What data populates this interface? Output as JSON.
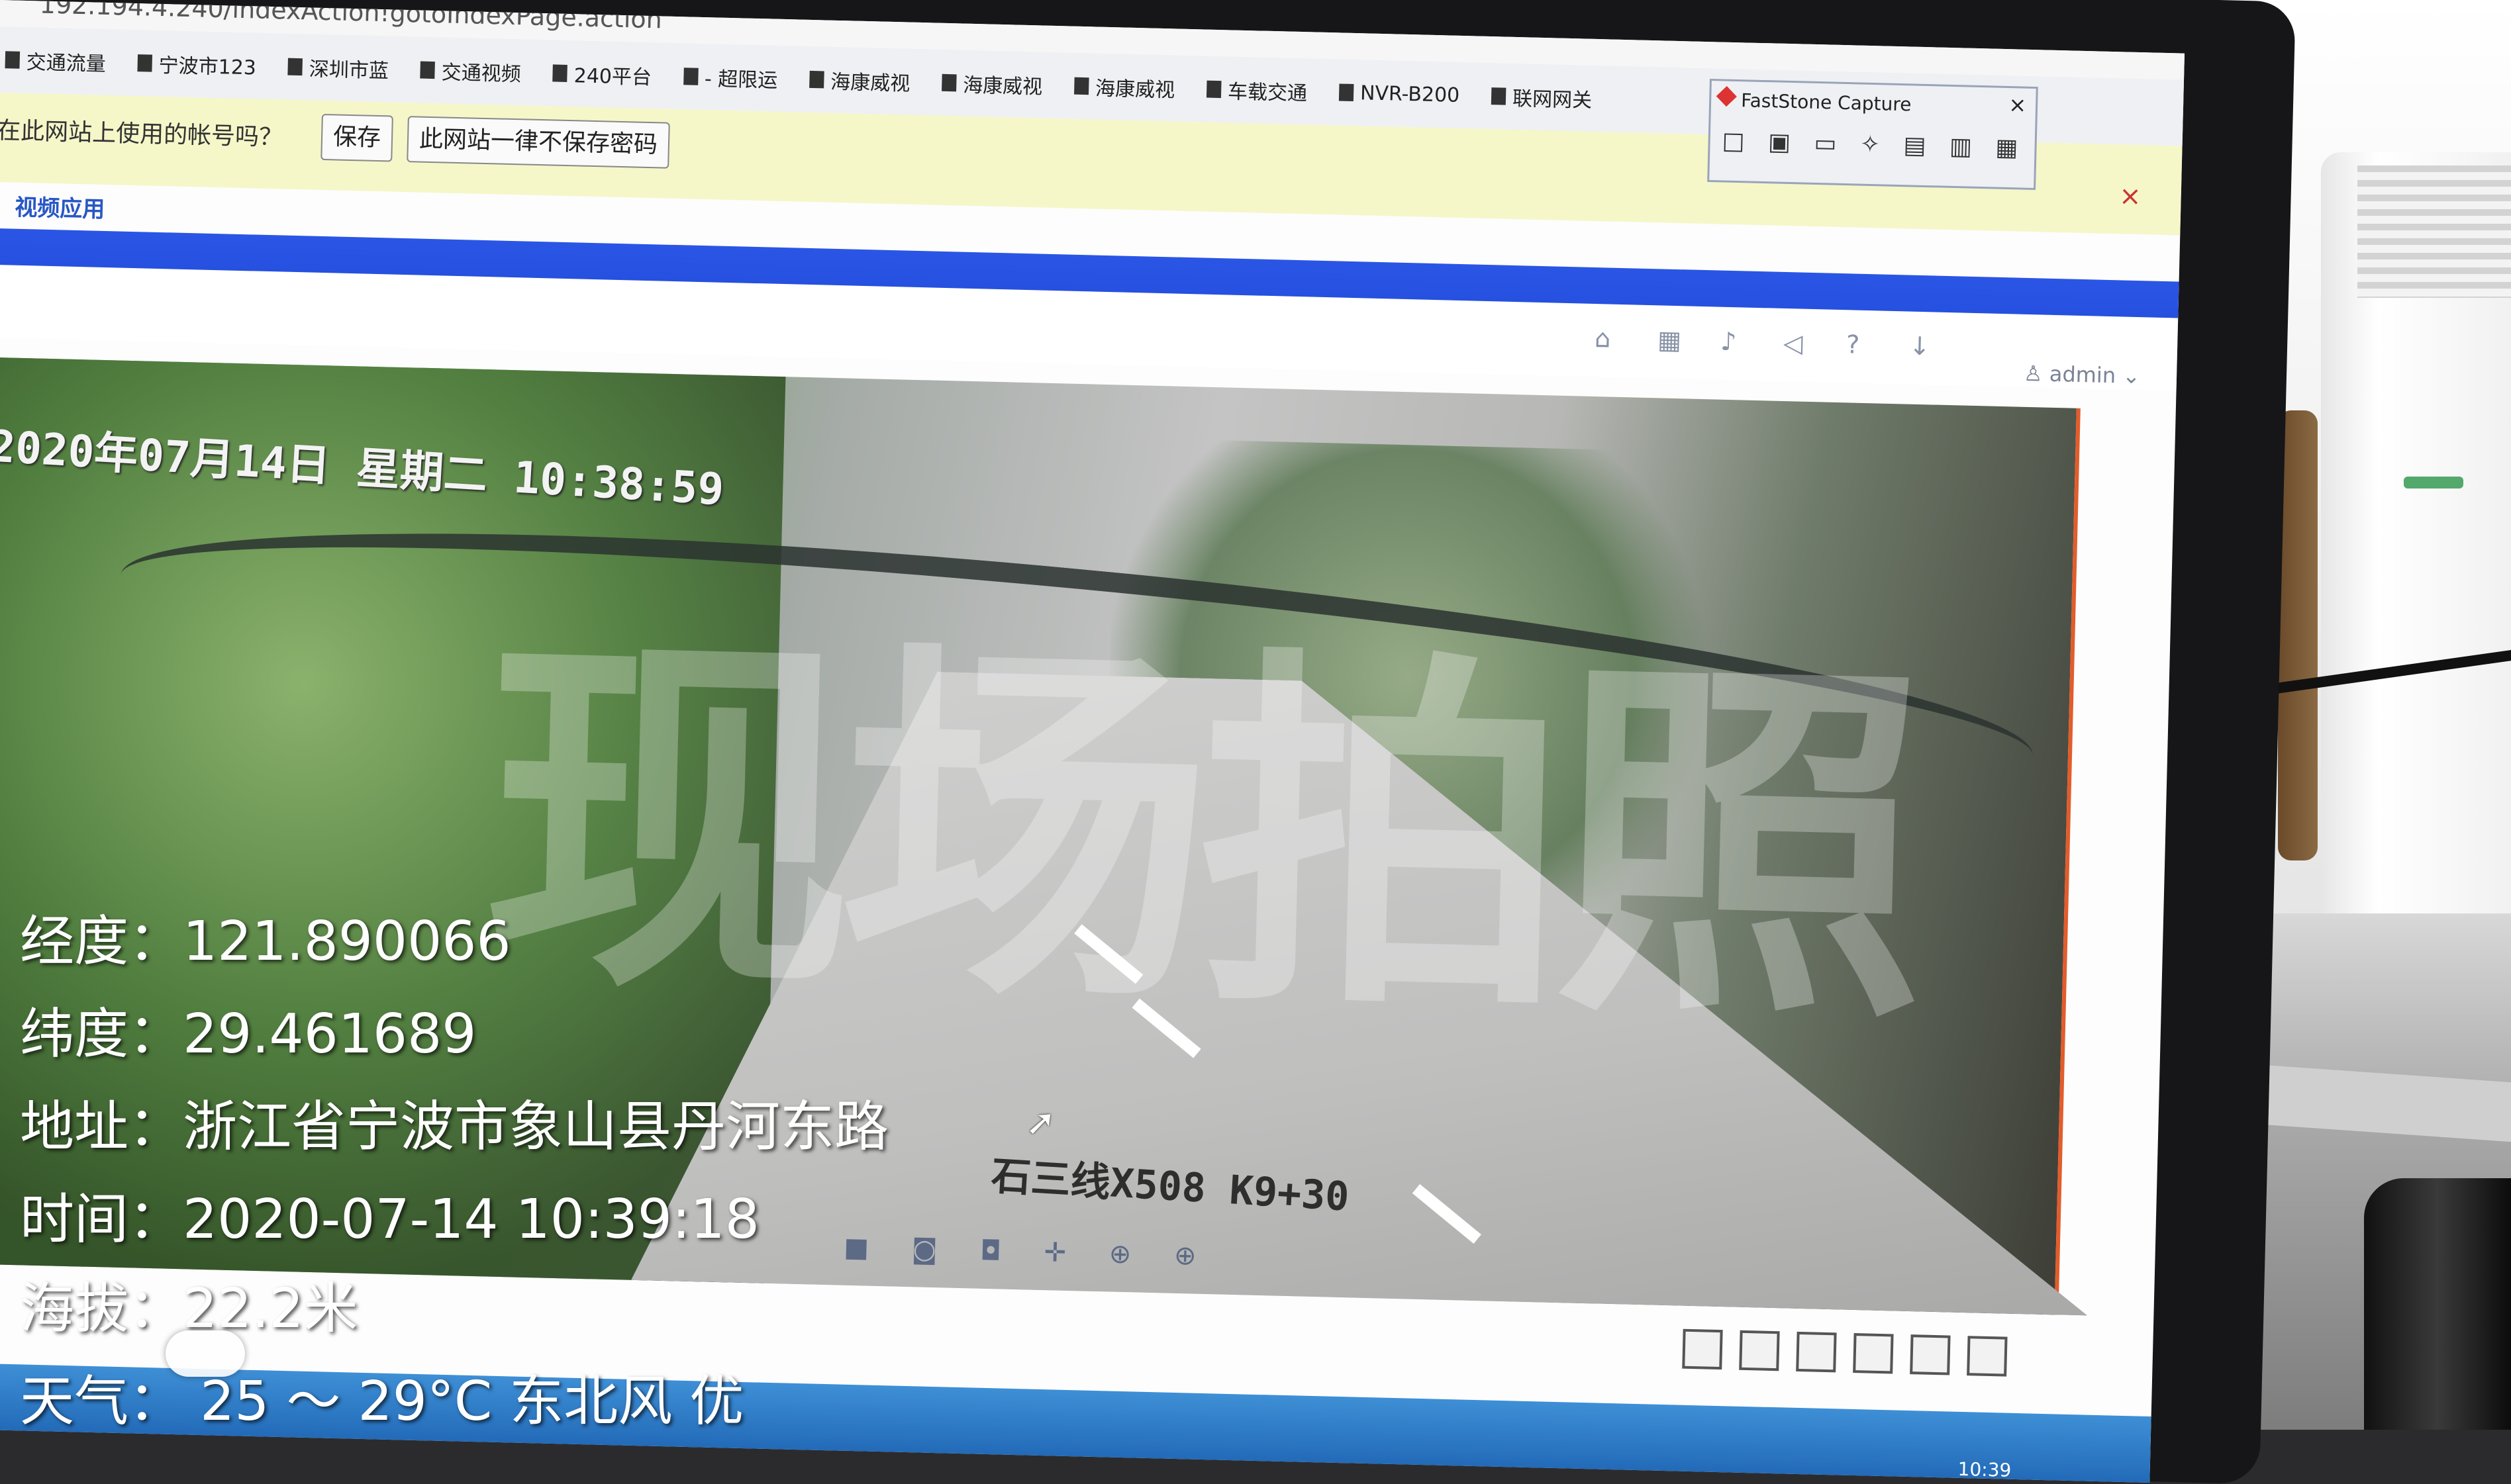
{
  "browser": {
    "url": "192.194.4.240/indexAction!gotoIndexPage.action",
    "bookmarks": [
      "交通流量",
      "宁波市123",
      "深圳市蓝",
      "交通视频",
      "240平台",
      "- 超限运",
      "海康威视",
      "海康威视",
      "海康威视",
      "车载交通",
      "NVR-B200",
      "联网网关"
    ]
  },
  "password_prompt": {
    "question": "在此网站上使用的帐号吗？",
    "save_label": "保存",
    "never_label": "此网站一律不保存密码",
    "close": "×"
  },
  "app": {
    "nav_link": "视频应用",
    "user": "admin"
  },
  "video": {
    "osd_datetime": "2020年07月14日 星期二 10:38:59",
    "osd_road": "石三线X508 K9+30",
    "watermark": "现场拍照"
  },
  "faststone": {
    "title": "FastStone Capture",
    "close": "×"
  },
  "overlay": {
    "longitude": "经度：121.890066",
    "latitude": "纬度：29.461689",
    "address": "地址：浙江省宁波市象山县丹河东路",
    "time": "时间：2020-07-14 10:39:18",
    "altitude": "海拔：22.2米",
    "weather": "天气：  25 ～ 29°C 东北风 优"
  },
  "taskbar": {
    "clock": "10:39"
  },
  "icons": [
    "home-icon",
    "grid-icon",
    "bell-icon",
    "speaker-icon",
    "help-icon",
    "download-icon",
    "user-icon",
    "chevron-down-icon",
    "close-icon",
    "star-icon",
    "menu-icon"
  ]
}
